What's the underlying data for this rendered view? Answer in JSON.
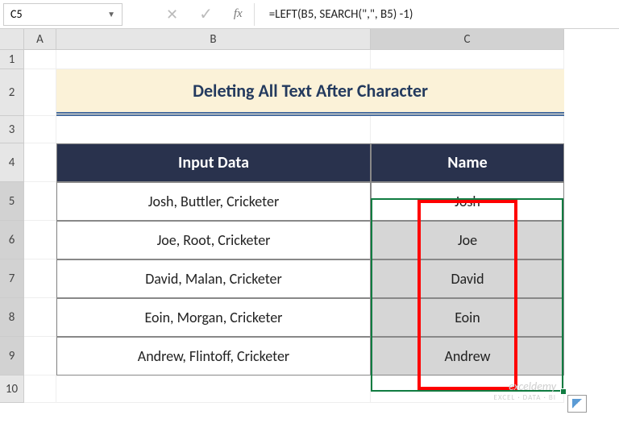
{
  "namebox": {
    "cell_ref": "C5"
  },
  "formula_bar": {
    "formula": "=LEFT(B5, SEARCH(\",\", B5) -1)"
  },
  "columns": [
    "A",
    "B",
    "C"
  ],
  "rows": [
    "1",
    "2",
    "3",
    "4",
    "5",
    "6",
    "7",
    "8",
    "9",
    "10"
  ],
  "title": "Deleting All Text After Character",
  "headers": {
    "input": "Input Data",
    "name": "Name"
  },
  "data_rows": [
    {
      "input": "Josh, Buttler, Cricketer",
      "name": "Josh"
    },
    {
      "input": "Joe, Root, Cricketer",
      "name": "Joe"
    },
    {
      "input": "David, Malan, Cricketer",
      "name": "David"
    },
    {
      "input": "Eoin, Morgan, Cricketer",
      "name": "Eoin"
    },
    {
      "input": "Andrew, Flintoff, Cricketer",
      "name": "Andrew"
    }
  ],
  "watermark": {
    "brand": "exceldemy",
    "tagline": "EXCEL · DATA · BI"
  },
  "chart_data": {
    "type": "table",
    "title": "Deleting All Text After Character",
    "columns": [
      "Input Data",
      "Name"
    ],
    "rows": [
      [
        "Josh, Buttler, Cricketer",
        "Josh"
      ],
      [
        "Joe, Root, Cricketer",
        "Joe"
      ],
      [
        "David, Malan, Cricketer",
        "David"
      ],
      [
        "Eoin, Morgan, Cricketer",
        "Eoin"
      ],
      [
        "Andrew, Flintoff, Cricketer",
        "Andrew"
      ]
    ],
    "active_cell": "C5",
    "formula": "=LEFT(B5, SEARCH(\",\", B5) -1)"
  }
}
